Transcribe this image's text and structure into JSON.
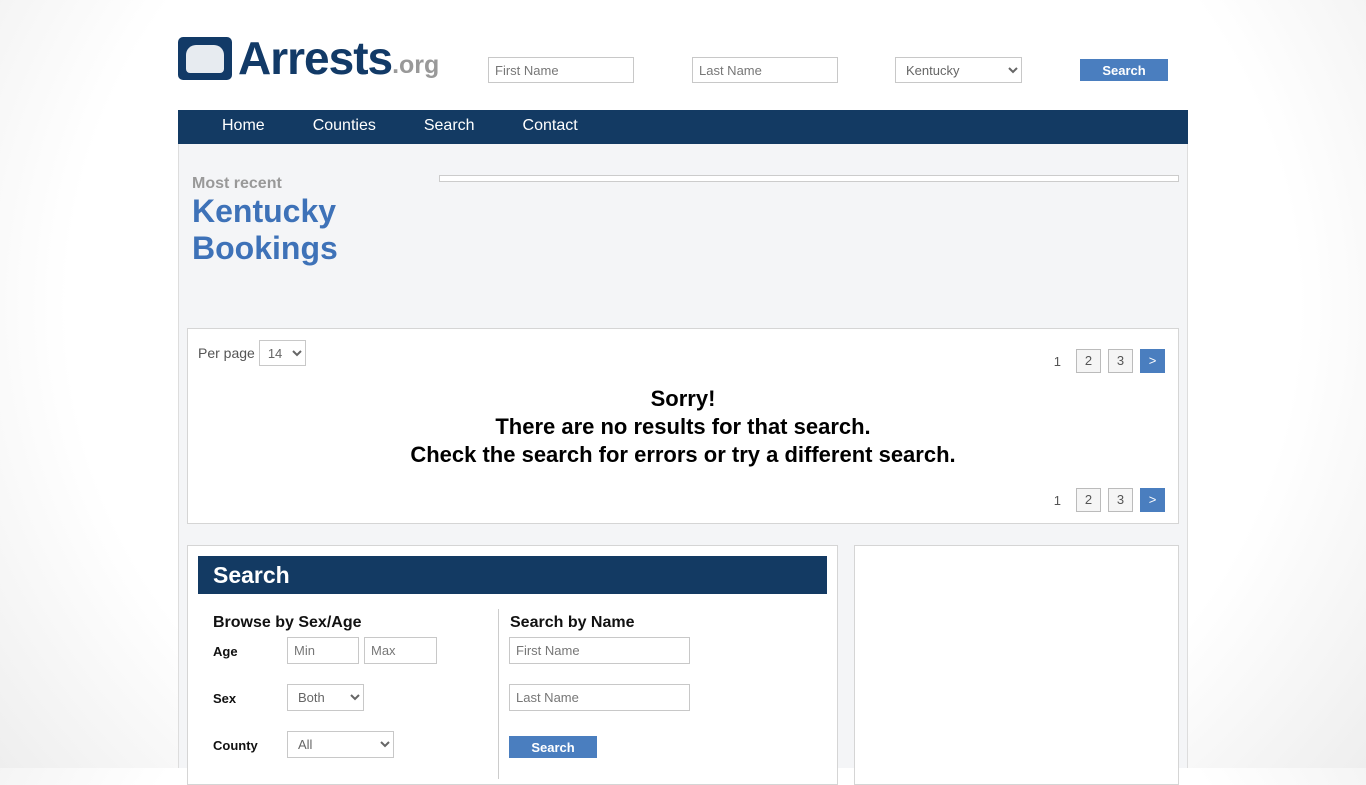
{
  "logo": {
    "text": "Arrests",
    "suffix": ".org"
  },
  "header": {
    "first_placeholder": "First Name",
    "last_placeholder": "Last Name",
    "state": "Kentucky",
    "search": "Search"
  },
  "nav": [
    "Home",
    "Counties",
    "Search",
    "Contact"
  ],
  "hero": {
    "kicker": "Most recent",
    "title1": "Kentucky",
    "title2": "Bookings"
  },
  "results": {
    "per_page_label": "Per page",
    "per_page": "14",
    "pages": [
      "1",
      "2",
      "3",
      ">"
    ],
    "msg1": "Sorry!",
    "msg2": "There are no results for that search.",
    "msg3": "Check the search for errors or try a different search."
  },
  "search": {
    "title": "Search",
    "browse_title": "Browse by Sex/Age",
    "age_label": "Age",
    "min": "Min",
    "max": "Max",
    "sex_label": "Sex",
    "sex": "Both",
    "county_label": "County",
    "county": "All",
    "name_title": "Search by Name",
    "first": "First Name",
    "last": "Last Name",
    "button": "Search"
  }
}
